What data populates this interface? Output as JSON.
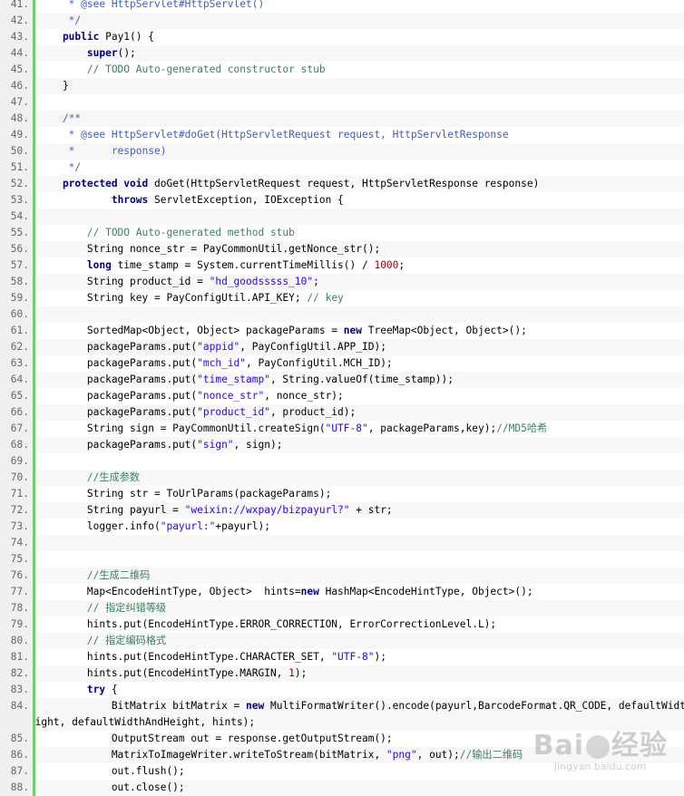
{
  "lines": [
    {
      "n": "41.",
      "t": [
        [
          "jd",
          "     * @see HttpServlet#HttpServlet()"
        ]
      ]
    },
    {
      "n": "42.",
      "t": [
        [
          "jd",
          "     */"
        ]
      ]
    },
    {
      "n": "43.",
      "t": [
        [
          "kw",
          "    public"
        ],
        [
          "",
          " Pay1() {"
        ]
      ]
    },
    {
      "n": "44.",
      "t": [
        [
          "",
          "        "
        ],
        [
          "kw",
          "super"
        ],
        [
          "",
          "();"
        ]
      ]
    },
    {
      "n": "45.",
      "t": [
        [
          "cm",
          "        // TODO Auto-generated constructor stub"
        ]
      ]
    },
    {
      "n": "46.",
      "t": [
        [
          "",
          "    }"
        ]
      ]
    },
    {
      "n": "47.",
      "t": [
        [
          "",
          ""
        ]
      ]
    },
    {
      "n": "48.",
      "t": [
        [
          "jd",
          "    /**"
        ]
      ]
    },
    {
      "n": "49.",
      "t": [
        [
          "jd",
          "     * @see HttpServlet#doGet(HttpServletRequest request, HttpServletResponse"
        ]
      ]
    },
    {
      "n": "50.",
      "t": [
        [
          "jd",
          "     *      response)"
        ]
      ]
    },
    {
      "n": "51.",
      "t": [
        [
          "jd",
          "     */"
        ]
      ]
    },
    {
      "n": "52.",
      "t": [
        [
          "kw",
          "    protected void"
        ],
        [
          "",
          " doGet(HttpServletRequest request, HttpServletResponse response)"
        ]
      ]
    },
    {
      "n": "53.",
      "t": [
        [
          "",
          "            "
        ],
        [
          "kw",
          "throws"
        ],
        [
          "",
          " ServletException, IOException {"
        ]
      ]
    },
    {
      "n": "54.",
      "t": [
        [
          "",
          ""
        ]
      ]
    },
    {
      "n": "55.",
      "t": [
        [
          "cm",
          "        // TODO Auto-generated method stub"
        ]
      ]
    },
    {
      "n": "56.",
      "t": [
        [
          "",
          "        String nonce_str = PayCommonUtil.getNonce_str();"
        ]
      ]
    },
    {
      "n": "57.",
      "t": [
        [
          "kw",
          "        long"
        ],
        [
          "",
          " time_stamp = System.currentTimeMillis() / "
        ],
        [
          "nu",
          "1000"
        ],
        [
          "",
          ";"
        ]
      ]
    },
    {
      "n": "58.",
      "t": [
        [
          "",
          "        String product_id = "
        ],
        [
          "st",
          "\"hd_goodsssss_10\""
        ],
        [
          "",
          ";"
        ]
      ]
    },
    {
      "n": "59.",
      "t": [
        [
          "",
          "        String key = PayConfigUtil.API_KEY; "
        ],
        [
          "cm",
          "// key"
        ]
      ]
    },
    {
      "n": "60.",
      "t": [
        [
          "",
          ""
        ]
      ]
    },
    {
      "n": "61.",
      "t": [
        [
          "",
          "        SortedMap<Object, Object> packageParams = "
        ],
        [
          "kw",
          "new"
        ],
        [
          "",
          " TreeMap<Object, Object>();"
        ]
      ]
    },
    {
      "n": "62.",
      "t": [
        [
          "",
          "        packageParams.put("
        ],
        [
          "st",
          "\"appid\""
        ],
        [
          "",
          ", PayConfigUtil.APP_ID);"
        ]
      ]
    },
    {
      "n": "63.",
      "t": [
        [
          "",
          "        packageParams.put("
        ],
        [
          "st",
          "\"mch_id\""
        ],
        [
          "",
          ", PayConfigUtil.MCH_ID);"
        ]
      ]
    },
    {
      "n": "64.",
      "t": [
        [
          "",
          "        packageParams.put("
        ],
        [
          "st",
          "\"time_stamp\""
        ],
        [
          "",
          ", String.valueOf(time_stamp));"
        ]
      ]
    },
    {
      "n": "65.",
      "t": [
        [
          "",
          "        packageParams.put("
        ],
        [
          "st",
          "\"nonce_str\""
        ],
        [
          "",
          ", nonce_str);"
        ]
      ]
    },
    {
      "n": "66.",
      "t": [
        [
          "",
          "        packageParams.put("
        ],
        [
          "st",
          "\"product_id\""
        ],
        [
          "",
          ", product_id);"
        ]
      ]
    },
    {
      "n": "67.",
      "t": [
        [
          "",
          "        String sign = PayCommonUtil.createSign("
        ],
        [
          "st",
          "\"UTF-8\""
        ],
        [
          "",
          ", packageParams,key);"
        ],
        [
          "cm",
          "//MD5哈希"
        ]
      ]
    },
    {
      "n": "68.",
      "t": [
        [
          "",
          "        packageParams.put("
        ],
        [
          "st",
          "\"sign\""
        ],
        [
          "",
          ", sign);"
        ]
      ]
    },
    {
      "n": "69.",
      "t": [
        [
          "",
          ""
        ]
      ]
    },
    {
      "n": "70.",
      "t": [
        [
          "cm",
          "        //生成参数"
        ]
      ]
    },
    {
      "n": "71.",
      "t": [
        [
          "",
          "        String str = ToUrlParams(packageParams);"
        ]
      ]
    },
    {
      "n": "72.",
      "t": [
        [
          "",
          "        String payurl = "
        ],
        [
          "st",
          "\"weixin://wxpay/bizpayurl?\""
        ],
        [
          "",
          " + str;"
        ]
      ]
    },
    {
      "n": "73.",
      "t": [
        [
          "",
          "        logger.info("
        ],
        [
          "st",
          "\"payurl:\""
        ],
        [
          "",
          "+payurl);"
        ]
      ]
    },
    {
      "n": "74.",
      "t": [
        [
          "",
          ""
        ]
      ]
    },
    {
      "n": "75.",
      "t": [
        [
          "",
          ""
        ]
      ]
    },
    {
      "n": "76.",
      "t": [
        [
          "cm",
          "        //生成二维码"
        ]
      ]
    },
    {
      "n": "77.",
      "t": [
        [
          "",
          "        Map<EncodeHintType, Object>  hints="
        ],
        [
          "kw",
          "new"
        ],
        [
          "",
          " HashMap<EncodeHintType, Object>();"
        ]
      ]
    },
    {
      "n": "78.",
      "t": [
        [
          "cm",
          "        // 指定纠错等级"
        ]
      ]
    },
    {
      "n": "79.",
      "t": [
        [
          "",
          "        hints.put(EncodeHintType.ERROR_CORRECTION, ErrorCorrectionLevel.L);"
        ]
      ]
    },
    {
      "n": "80.",
      "t": [
        [
          "cm",
          "        // 指定编码格式"
        ]
      ]
    },
    {
      "n": "81.",
      "t": [
        [
          "",
          "        hints.put(EncodeHintType.CHARACTER_SET, "
        ],
        [
          "st",
          "\"UTF-8\""
        ],
        [
          "",
          ");"
        ]
      ]
    },
    {
      "n": "82.",
      "t": [
        [
          "",
          "        hints.put(EncodeHintType.MARGIN, "
        ],
        [
          "nu",
          "1"
        ],
        [
          "",
          ");"
        ]
      ]
    },
    {
      "n": "83.",
      "t": [
        [
          "kw",
          "        try"
        ],
        [
          "",
          " {"
        ]
      ]
    },
    {
      "n": "84.",
      "wrap": true,
      "t": [
        [
          "",
          "            BitMatrix bitMatrix = "
        ],
        [
          "kw",
          "new"
        ],
        [
          "",
          " MultiFormatWriter().encode(payurl,BarcodeFormat.QR_CODE, defaultWidth"
        ]
      ],
      "t2": [
        [
          "",
          "AndHeight, defaultWidthAndHeight, hints);"
        ]
      ]
    },
    {
      "n": "85.",
      "t": [
        [
          "",
          "            OutputStream out = response.getOutputStream();"
        ]
      ]
    },
    {
      "n": "86.",
      "t": [
        [
          "",
          "            MatrixToImageWriter.writeToStream(bitMatrix, "
        ],
        [
          "st",
          "\"png\""
        ],
        [
          "",
          ", out);"
        ],
        [
          "cm",
          "//输出二维码"
        ]
      ]
    },
    {
      "n": "87.",
      "t": [
        [
          "",
          "            out.flush();"
        ]
      ]
    },
    {
      "n": "88.",
      "t": [
        [
          "",
          "            out.close();"
        ]
      ]
    }
  ],
  "watermark": {
    "logo_left": "Bai",
    "logo_right": "经验",
    "sub": "jingyan.baidu.com"
  }
}
